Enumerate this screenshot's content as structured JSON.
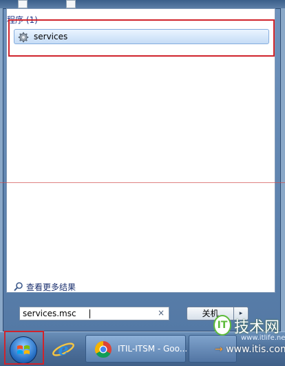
{
  "start_menu": {
    "section_header": "程序 (1)",
    "program_item": {
      "label": "services",
      "icon": "gear-icon"
    },
    "see_more": {
      "label": "查看更多结果",
      "icon": "search-icon"
    },
    "search": {
      "value": "services.msc",
      "clear_label": "×"
    },
    "shutdown": {
      "label": "关机",
      "arrow_label": "▸"
    }
  },
  "taskbar": {
    "start_button_icon": "windows-flag-icon",
    "ie_icon": "internet-explorer-icon",
    "chrome_task": {
      "label": "ITIL-ITSM - Goo...",
      "icon": "chrome-icon"
    }
  },
  "watermark": {
    "title": "技术网",
    "logo_text": "IT",
    "url_small": "www.itlife.net",
    "url_large": "www.itis.com",
    "url_large_arrow": "→"
  },
  "colors": {
    "highlight_red": "#d0232b",
    "header_blue": "#1e3287",
    "selection_border": "#84acdd"
  }
}
